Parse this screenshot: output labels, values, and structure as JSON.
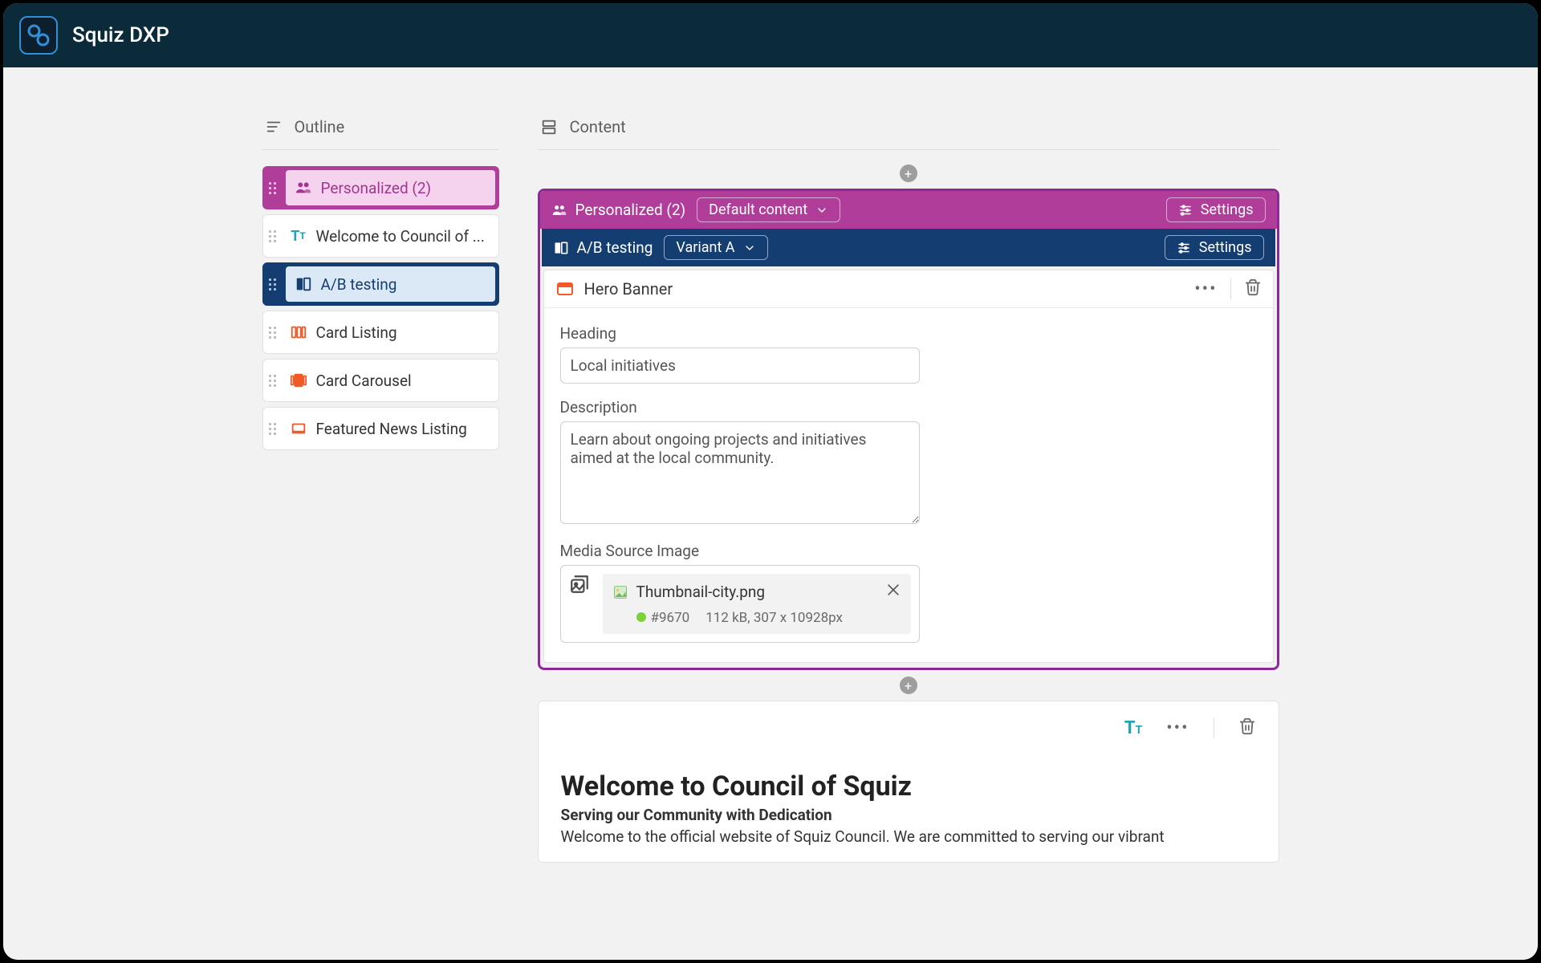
{
  "app": {
    "title": "Squiz DXP"
  },
  "sidebar": {
    "header": "Outline",
    "items": [
      {
        "label": "Personalized (2)",
        "kind": "personalized"
      },
      {
        "label": "Welcome to Council of ...",
        "kind": "text"
      },
      {
        "label": "A/B testing",
        "kind": "ab"
      },
      {
        "label": "Card Listing",
        "kind": "component-orange"
      },
      {
        "label": "Card Carousel",
        "kind": "component-orange"
      },
      {
        "label": "Featured News Listing",
        "kind": "component-orange-fill"
      }
    ]
  },
  "content": {
    "header": "Content",
    "personalized": {
      "label": "Personalized (2)",
      "dropdown": "Default content",
      "settings": "Settings"
    },
    "ab": {
      "label": "A/B testing",
      "dropdown": "Variant A",
      "settings": "Settings"
    },
    "hero": {
      "title": "Hero Banner",
      "heading_label": "Heading",
      "heading_value": "Local initiatives",
      "description_label": "Description",
      "description_value": "Learn about ongoing projects and initiatives aimed at the local community.",
      "media_label": "Media Source Image",
      "media": {
        "name": "Thumbnail-city.png",
        "id": "#9670",
        "meta": "112 kB, 307 x 10928px"
      }
    },
    "text_block": {
      "title": "Welcome to Council of Squiz",
      "subtitle": "Serving our Community with Dedication",
      "body": "Welcome to the official website of Squiz Council. We are committed to serving our vibrant"
    }
  }
}
